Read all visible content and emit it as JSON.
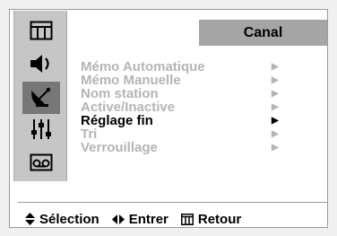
{
  "header": {
    "title": "Canal"
  },
  "menu": {
    "items": [
      {
        "label": "Mémo Automatique",
        "selected": false
      },
      {
        "label": "Mémo Manuelle",
        "selected": false
      },
      {
        "label": "Nom station",
        "selected": false
      },
      {
        "label": "Active/Inactive",
        "selected": false
      },
      {
        "label": "Réglage fin",
        "selected": true
      },
      {
        "label": "Tri",
        "selected": false
      },
      {
        "label": "Verrouillage",
        "selected": false
      }
    ],
    "arrow_glyph": "▶"
  },
  "sidebar": {
    "icons": [
      "picture-icon",
      "sound-icon",
      "channel-icon",
      "setup-icon",
      "function-icon"
    ],
    "active": "channel-icon"
  },
  "footer": {
    "select_label": "Sélection",
    "enter_label": "Entrer",
    "return_label": "Retour"
  }
}
